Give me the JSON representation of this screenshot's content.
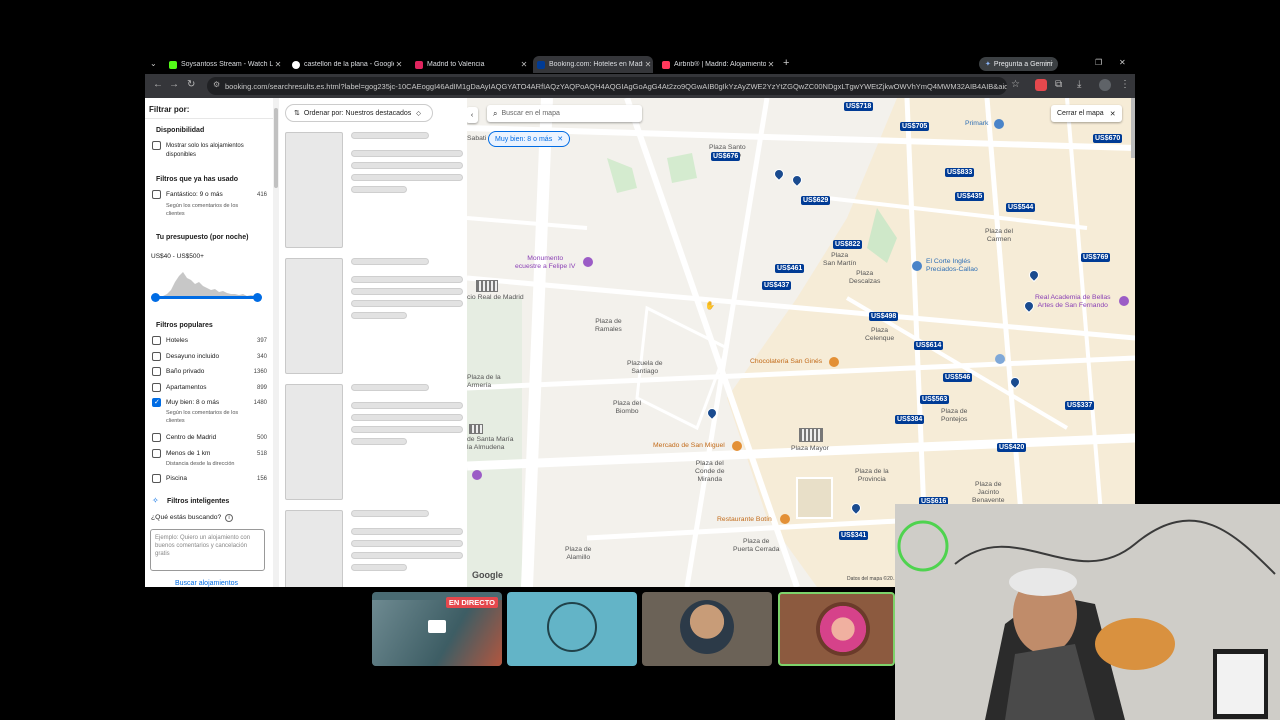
{
  "browser": {
    "tabs": [
      {
        "label": "Soysantoss Stream - Watch Liv…",
        "color": "#53fc18"
      },
      {
        "label": "castellon de la plana - Google…",
        "color": "#ffffff"
      },
      {
        "label": "Madrid to Valencia",
        "color": "#e0245e"
      },
      {
        "label": "Booking.com: Hoteles en Madr…",
        "color": "#003b95"
      },
      {
        "label": "Airbnb® | Madrid: Alojamiento…",
        "color": "#ff385c"
      }
    ],
    "new_tab": "+",
    "gemini": "Pregunta a Gemini",
    "url": "booking.com/searchresults.es.html?label=gog235jc-10CAEoggI46AdIM1gDaAyIAQGYATO4ARfIAQzYAQPoAQH4AQGIAgGoAgG4At2zo9QGwAIB0gIkYzAyZWE2YzYtZGQwZC00NDgxLTgwYWEtZjkwOWVhYmQ4MWM32AIB4AIB&aid=397594&sss=…",
    "window_controls": [
      "—",
      "❐",
      "✕"
    ]
  },
  "filters": {
    "title": "Filtrar por:",
    "availability_title": "Disponibilidad",
    "availability_label": "Mostrar solo los alojamientos disponibles",
    "used_title": "Filtros que ya has usado",
    "used_label": "Fantástico: 9 o más",
    "used_sub": "Según los comentarios de los clientes",
    "used_count": "416",
    "budget_title": "Tu presupuesto (por noche)",
    "budget_range": "US$40 - US$500+",
    "popular_title": "Filtros populares",
    "popular": [
      {
        "label": "Hoteles",
        "count": "397",
        "checked": false,
        "sub": ""
      },
      {
        "label": "Desayuno incluido",
        "count": "340",
        "checked": false,
        "sub": ""
      },
      {
        "label": "Baño privado",
        "count": "1360",
        "checked": false,
        "sub": ""
      },
      {
        "label": "Apartamentos",
        "count": "899",
        "checked": false,
        "sub": ""
      },
      {
        "label": "Muy bien: 8 o más",
        "count": "1480",
        "checked": true,
        "sub": "Según los comentarios de los clientes"
      },
      {
        "label": "Centro de Madrid",
        "count": "500",
        "checked": false,
        "sub": ""
      },
      {
        "label": "Menos de 1 km",
        "count": "518",
        "checked": false,
        "sub": "Distancia desde la dirección"
      },
      {
        "label": "Piscina",
        "count": "156",
        "checked": false,
        "sub": ""
      }
    ],
    "smart_title": "Filtros inteligentes",
    "smart_question": "¿Qué estás buscando?",
    "smart_placeholder": "Ejemplo: Quiero un alojamiento con buenos comentarios y cancelación gratis",
    "smart_button": "Buscar alojamientos"
  },
  "results": {
    "sort_label": "Ordenar por: Nuestros destacados"
  },
  "map": {
    "search_placeholder": "Buscar en el mapa",
    "close_label": "Cerrar el mapa",
    "active_chip": "Muy bien: 8 o más",
    "google": "Google",
    "attribution": "Datos del mapa ©20…",
    "prices": [
      "US$718",
      "US$705",
      "US$670",
      "US$676",
      "US$833",
      "US$435",
      "US$544",
      "US$629",
      "US$822",
      "US$769",
      "US$461",
      "US$437",
      "US$498",
      "US$614",
      "US$546",
      "US$563",
      "US$384",
      "US$337",
      "US$420",
      "US$616",
      "US$341"
    ],
    "labels": {
      "sabati": "Sabati",
      "plaza_santo_domingo": "Plaza Santo\nDomingo",
      "primark": "Primark",
      "plaza_carmen": "Plaza del\nCarmen",
      "corte_ingles": "El Corte Inglés\nPreciados-Callao",
      "monumento": "Monumento\necuestre a Felipe IV",
      "plaza_san_martin": "Plaza\nSan Martín",
      "plaza_descalzas": "Plaza\nDescalzas",
      "palacio_real": "cio Real de Madrid",
      "academia": "Real Academia de Bellas\nArtes de San Fernando",
      "plaza_ramales": "Plaza de\nRamales",
      "plaza_celenque": "Plaza\nCelenque",
      "plazuela_santiago": "Plazuela de\nSantiago",
      "chocolateria": "Chocolatería San Ginés",
      "plaza_armeria": "Plaza de la\nArmería",
      "plaza_biombo": "Plaza del\nBiombo",
      "plaza_pontejos": "Plaza de\nPontejos",
      "santa_maria": "de Santa María\nla Almudena",
      "mercado": "Mercado de San Miguel",
      "plaza_mayor": "Plaza Mayor",
      "plaza_conde_miranda": "Plaza del\nConde de\nMiranda",
      "plaza_provincia": "Plaza de la\nProvincia",
      "plaza_jacinto": "Plaza de\nJacinto\nBenavente",
      "botin": "Restaurante Botín",
      "plaza_alamillo": "Plaza de\nAlamillo",
      "puerta_cerrada": "Plaza de\nPuerta Cerrada"
    }
  },
  "stream": {
    "live_badge": "EN DIRECTO"
  },
  "colors": {
    "booking_blue": "#003b95",
    "link_blue": "#006ce4",
    "live_red": "#e5484d"
  }
}
